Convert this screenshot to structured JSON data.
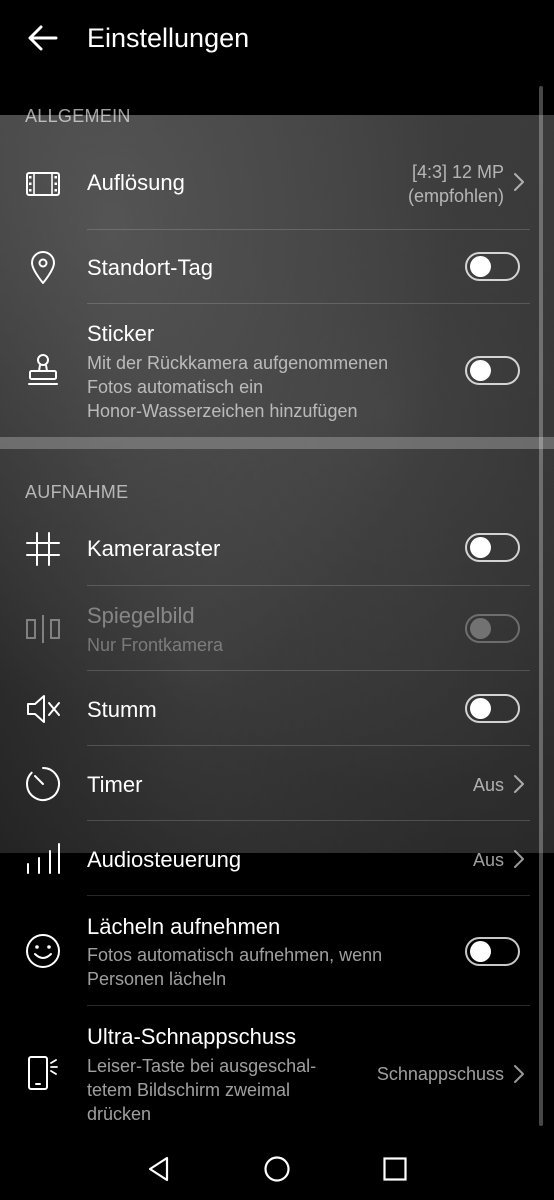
{
  "header": {
    "title": "Einstellungen"
  },
  "sections": {
    "general": "ALLGEMEIN",
    "capture": "AUFNAHME"
  },
  "settings": {
    "resolution": {
      "label": "Auflösung",
      "value_line1": "[4:3] 12 MP",
      "value_line2": "(empfohlen)"
    },
    "location_tag": {
      "label": "Standort-Tag",
      "enabled": false
    },
    "sticker": {
      "label": "Sticker",
      "sub1": "Mit der Rückkamera aufgenommenen",
      "sub2": "Fotos automatisch ein",
      "sub3": "Honor-Wasserzeichen hinzufügen",
      "enabled": false
    },
    "grid": {
      "label": "Kameraraster",
      "enabled": false
    },
    "mirror": {
      "label": "Spiegelbild",
      "sub": "Nur Frontkamera",
      "enabled": false,
      "disabled": true
    },
    "mute": {
      "label": "Stumm",
      "enabled": false
    },
    "timer": {
      "label": "Timer",
      "value": "Aus"
    },
    "audio_control": {
      "label": "Audiosteuerung",
      "value": "Aus"
    },
    "smile_capture": {
      "label": "Lächeln aufnehmen",
      "sub1": "Fotos automatisch aufnehmen, wenn",
      "sub2": "Personen lächeln",
      "enabled": false
    },
    "ultra_snapshot": {
      "label": "Ultra-Schnappschuss",
      "sub1": "Leiser-Taste bei ausgeschal-",
      "sub2": "tetem Bildschirm zweimal",
      "sub3": "drücken",
      "value": "Schnappschuss"
    }
  },
  "icons": {
    "back": "arrow-left-icon",
    "resolution": "film-frame-icon",
    "location": "location-pin-icon",
    "sticker": "stamp-icon",
    "grid": "grid-icon",
    "mirror": "mirror-icon",
    "mute": "speaker-muted-icon",
    "timer": "timer-icon",
    "audio": "audio-bars-icon",
    "smile": "smile-icon",
    "ultra": "phone-snapshot-icon"
  }
}
